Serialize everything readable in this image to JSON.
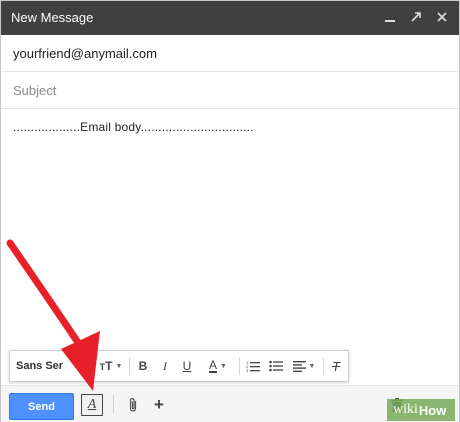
{
  "window": {
    "title": "New Message",
    "minimize_glyph": "—",
    "popout_glyph": "↗",
    "close_glyph": "✕"
  },
  "fields": {
    "to_value": "yourfriend@anymail.com",
    "subject_placeholder": "Subject",
    "body_text": "...................Email body................................"
  },
  "format_toolbar": {
    "font_name": "Sans Ser",
    "font_size_glyph": "T",
    "bold": "B",
    "italic": "I",
    "underline": "U",
    "text_color": "A",
    "ordered_list_icon": "numbered-list-icon",
    "bullet_list_icon": "bulleted-list-icon",
    "align_icon": "align-icon",
    "clear_format": "T"
  },
  "actions": {
    "send_label": "Send",
    "format_toggle": "A",
    "attach_icon": "paperclip-icon",
    "more_label": "+",
    "trash_icon": "trash-icon"
  },
  "watermark": {
    "prefix": "wiki",
    "suffix": "How"
  },
  "colors": {
    "titlebar": "#404040",
    "send_button": "#4d90fe",
    "arrow": "#e8202a"
  }
}
